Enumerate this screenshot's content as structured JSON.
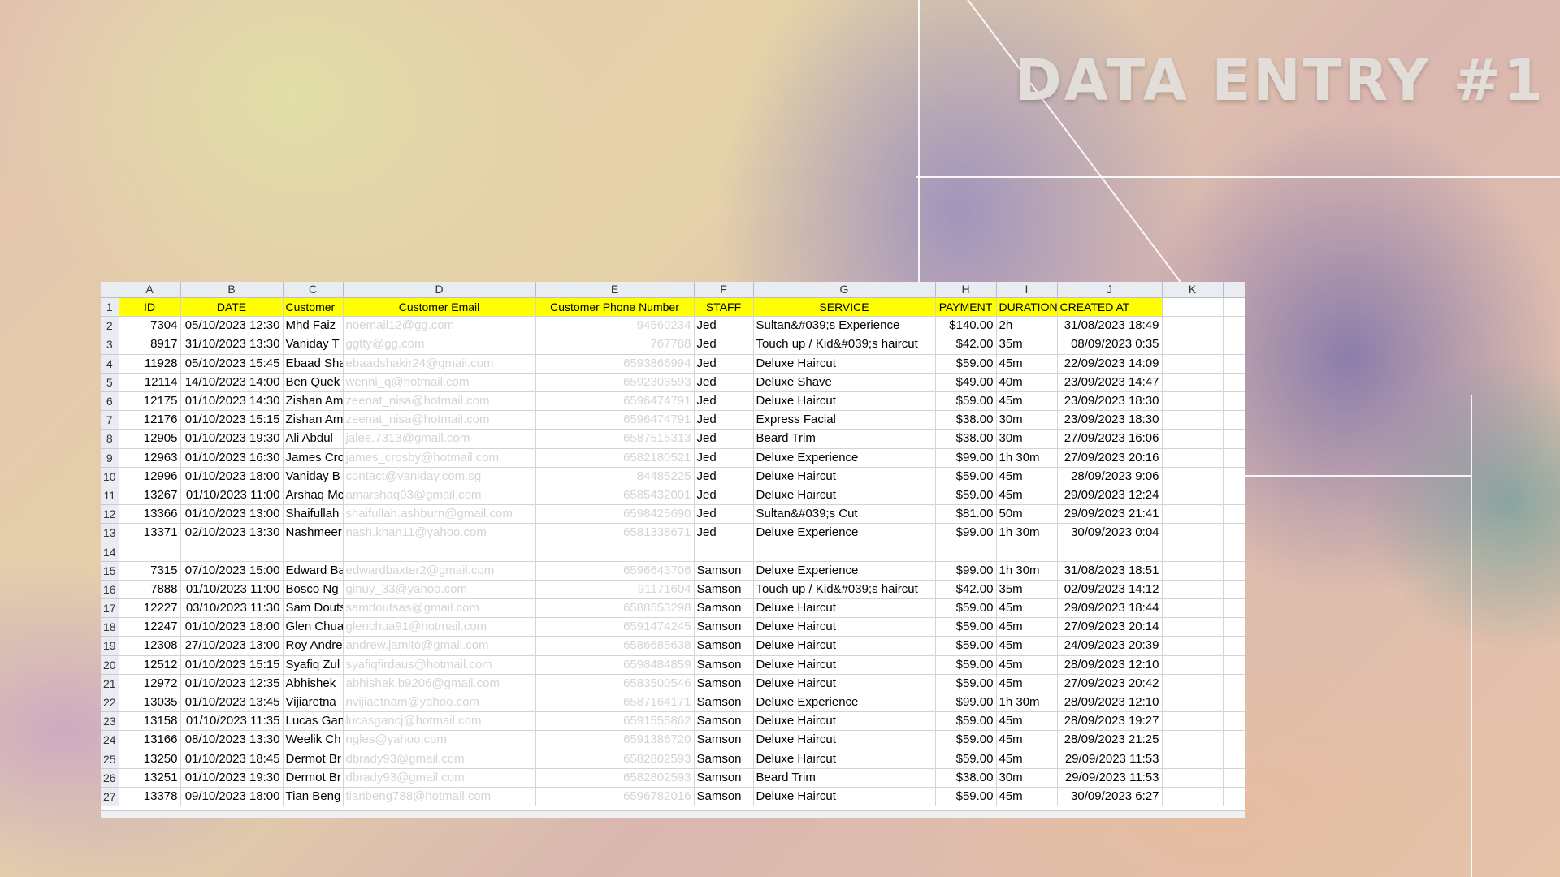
{
  "title": "DATA ENTRY #1",
  "columns": [
    "A",
    "B",
    "C",
    "D",
    "E",
    "F",
    "G",
    "H",
    "I",
    "J",
    "K"
  ],
  "headers": [
    "ID",
    "DATE",
    "Customer",
    "Customer Email",
    "Customer Phone Number",
    "STAFF",
    "SERVICE",
    "PAYMENT",
    "DURATION",
    "CREATED AT",
    ""
  ],
  "rows": [
    {
      "n": "2",
      "id": "7304",
      "date": "05/10/2023 12:30",
      "customer": "Mhd Faiz",
      "email": "noemail12@gg.com",
      "phone": "94560234",
      "staff": "Jed",
      "service": "Sultan&#039;s Experience",
      "payment": "$140.00",
      "duration": "2h",
      "created": "31/08/2023 18:49"
    },
    {
      "n": "3",
      "id": "8917",
      "date": "31/10/2023 13:30",
      "customer": "Vaniday T",
      "email": "ggtty@gg.com",
      "phone": "767788",
      "staff": "Jed",
      "service": "Touch up / Kid&#039;s haircut",
      "payment": "$42.00",
      "duration": "35m",
      "created": "08/09/2023 0:35"
    },
    {
      "n": "4",
      "id": "11928",
      "date": "05/10/2023 15:45",
      "customer": "Ebaad Sha",
      "email": "ebaadshakir24@gmail.com",
      "phone": "6593866994",
      "staff": "Jed",
      "service": "Deluxe Haircut",
      "payment": "$59.00",
      "duration": "45m",
      "created": "22/09/2023 14:09"
    },
    {
      "n": "5",
      "id": "12114",
      "date": "14/10/2023 14:00",
      "customer": "Ben Quek",
      "email": "wenni_q@hotmail.com",
      "phone": "6592303593",
      "staff": "Jed",
      "service": "Deluxe Shave",
      "payment": "$49.00",
      "duration": "40m",
      "created": "23/09/2023 14:47"
    },
    {
      "n": "6",
      "id": "12175",
      "date": "01/10/2023 14:30",
      "customer": "Zishan Am",
      "email": "zeenat_nisa@hotmail.com",
      "phone": "6596474791",
      "staff": "Jed",
      "service": "Deluxe Haircut",
      "payment": "$59.00",
      "duration": "45m",
      "created": "23/09/2023 18:30"
    },
    {
      "n": "7",
      "id": "12176",
      "date": "01/10/2023 15:15",
      "customer": "Zishan Am",
      "email": "zeenat_nisa@hotmail.com",
      "phone": "6596474791",
      "staff": "Jed",
      "service": "Express Facial",
      "payment": "$38.00",
      "duration": "30m",
      "created": "23/09/2023 18:30"
    },
    {
      "n": "8",
      "id": "12905",
      "date": "01/10/2023 19:30",
      "customer": "Ali Abdul",
      "email": "jalee.7313@gmail.com",
      "phone": "6587515313",
      "staff": "Jed",
      "service": "Beard Trim",
      "payment": "$38.00",
      "duration": "30m",
      "created": "27/09/2023 16:06"
    },
    {
      "n": "9",
      "id": "12963",
      "date": "01/10/2023 16:30",
      "customer": "James Cro",
      "email": "james_crosby@hotmail.com",
      "phone": "6582180521",
      "staff": "Jed",
      "service": "Deluxe Experience",
      "payment": "$99.00",
      "duration": "1h 30m",
      "created": "27/09/2023 20:16"
    },
    {
      "n": "10",
      "id": "12996",
      "date": "01/10/2023 18:00",
      "customer": "Vaniday B",
      "email": "contact@vaniday.com.sg",
      "phone": "84485225",
      "staff": "Jed",
      "service": "Deluxe Haircut",
      "payment": "$59.00",
      "duration": "45m",
      "created": "28/09/2023 9:06"
    },
    {
      "n": "11",
      "id": "13267",
      "date": "01/10/2023 11:00",
      "customer": "Arshaq Mc",
      "email": "amarshaq03@gmail.com",
      "phone": "6585432001",
      "staff": "Jed",
      "service": "Deluxe Haircut",
      "payment": "$59.00",
      "duration": "45m",
      "created": "29/09/2023 12:24"
    },
    {
      "n": "12",
      "id": "13366",
      "date": "01/10/2023 13:00",
      "customer": "Shaifullah",
      "email": "shaifullah.ashburn@gmail.com",
      "phone": "6598425690",
      "staff": "Jed",
      "service": "Sultan&#039;s Cut",
      "payment": "$81.00",
      "duration": "50m",
      "created": "29/09/2023 21:41"
    },
    {
      "n": "13",
      "id": "13371",
      "date": "02/10/2023 13:30",
      "customer": "Nashmeer",
      "email": "nash.khan11@yahoo.com",
      "phone": "6581338671",
      "staff": "Jed",
      "service": "Deluxe Experience",
      "payment": "$99.00",
      "duration": "1h 30m",
      "created": "30/09/2023 0:04"
    },
    {
      "n": "14",
      "id": "",
      "date": "",
      "customer": "",
      "email": "",
      "phone": "",
      "staff": "",
      "service": "",
      "payment": "",
      "duration": "",
      "created": ""
    },
    {
      "n": "15",
      "id": "7315",
      "date": "07/10/2023 15:00",
      "customer": "Edward Ba",
      "email": "edwardbaxter2@gmail.com",
      "phone": "6596643706",
      "staff": "Samson",
      "service": "Deluxe Experience",
      "payment": "$99.00",
      "duration": "1h 30m",
      "created": "31/08/2023 18:51"
    },
    {
      "n": "16",
      "id": "7888",
      "date": "01/10/2023 11:00",
      "customer": "Bosco Ng",
      "email": "ginuy_33@yahoo.com",
      "phone": "91171604",
      "staff": "Samson",
      "service": "Touch up / Kid&#039;s haircut",
      "payment": "$42.00",
      "duration": "35m",
      "created": "02/09/2023 14:12"
    },
    {
      "n": "17",
      "id": "12227",
      "date": "03/10/2023 11:30",
      "customer": "Sam Douts",
      "email": "samdoutsas@gmail.com",
      "phone": "6588553298",
      "staff": "Samson",
      "service": "Deluxe Haircut",
      "payment": "$59.00",
      "duration": "45m",
      "created": "29/09/2023 18:44"
    },
    {
      "n": "18",
      "id": "12247",
      "date": "01/10/2023 18:00",
      "customer": "Glen Chua",
      "email": "glenchua91@hotmail.com",
      "phone": "6591474245",
      "staff": "Samson",
      "service": "Deluxe Haircut",
      "payment": "$59.00",
      "duration": "45m",
      "created": "27/09/2023 20:14"
    },
    {
      "n": "19",
      "id": "12308",
      "date": "27/10/2023 13:00",
      "customer": "Roy Andre",
      "email": "andrew.jamito@gmail.com",
      "phone": "6586685638",
      "staff": "Samson",
      "service": "Deluxe Haircut",
      "payment": "$59.00",
      "duration": "45m",
      "created": "24/09/2023 20:39"
    },
    {
      "n": "20",
      "id": "12512",
      "date": "01/10/2023 15:15",
      "customer": "Syafiq Zul",
      "email": "syafiqfirdaus@hotmail.com",
      "phone": "6598484859",
      "staff": "Samson",
      "service": "Deluxe Haircut",
      "payment": "$59.00",
      "duration": "45m",
      "created": "28/09/2023 12:10"
    },
    {
      "n": "21",
      "id": "12972",
      "date": "01/10/2023 12:35",
      "customer": "Abhishek",
      "email": "abhishek.b9206@gmail.com",
      "phone": "6583500546",
      "staff": "Samson",
      "service": "Deluxe Haircut",
      "payment": "$59.00",
      "duration": "45m",
      "created": "27/09/2023 20:42"
    },
    {
      "n": "22",
      "id": "13035",
      "date": "01/10/2023 13:45",
      "customer": "Vijiaretna",
      "email": "nvijiaetnam@yahoo.com",
      "phone": "6587164171",
      "staff": "Samson",
      "service": "Deluxe Experience",
      "payment": "$99.00",
      "duration": "1h 30m",
      "created": "28/09/2023 12:10"
    },
    {
      "n": "23",
      "id": "13158",
      "date": "01/10/2023 11:35",
      "customer": "Lucas Gan",
      "email": "lucasgancj@hotmail.com",
      "phone": "6591555862",
      "staff": "Samson",
      "service": "Deluxe Haircut",
      "payment": "$59.00",
      "duration": "45m",
      "created": "28/09/2023 19:27"
    },
    {
      "n": "24",
      "id": "13166",
      "date": "08/10/2023 13:30",
      "customer": "Weelik Ch",
      "email": "ngles@yahoo.com",
      "phone": "6591386720",
      "staff": "Samson",
      "service": "Deluxe Haircut",
      "payment": "$59.00",
      "duration": "45m",
      "created": "28/09/2023 21:25"
    },
    {
      "n": "25",
      "id": "13250",
      "date": "01/10/2023 18:45",
      "customer": "Dermot Br",
      "email": "dbrady93@gmail.com",
      "phone": "6582802593",
      "staff": "Samson",
      "service": "Deluxe Haircut",
      "payment": "$59.00",
      "duration": "45m",
      "created": "29/09/2023 11:53"
    },
    {
      "n": "26",
      "id": "13251",
      "date": "01/10/2023 19:30",
      "customer": "Dermot Br",
      "email": "dbrady93@gmail.com",
      "phone": "6582802593",
      "staff": "Samson",
      "service": "Beard Trim",
      "payment": "$38.00",
      "duration": "30m",
      "created": "29/09/2023 11:53"
    },
    {
      "n": "27",
      "id": "13378",
      "date": "09/10/2023 18:00",
      "customer": "Tian Beng",
      "email": "tianbeng788@hotmail.com",
      "phone": "6596782016",
      "staff": "Samson",
      "service": "Deluxe Haircut",
      "payment": "$59.00",
      "duration": "45m",
      "created": "30/09/2023 6:27"
    }
  ]
}
